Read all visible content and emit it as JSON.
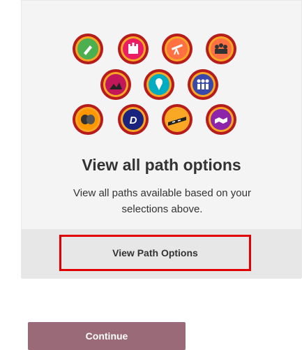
{
  "card": {
    "title": "View all path options",
    "description": "View all paths available based on your selections above.",
    "button_label": "View Path Options"
  },
  "footer": {
    "continue_label": "Continue"
  },
  "badges": [
    {
      "name": "microphone-badge-icon",
      "color": "#4caf50"
    },
    {
      "name": "castle-badge-icon",
      "color": "#e91e63"
    },
    {
      "name": "telescope-badge-icon",
      "color": "#ff7043"
    },
    {
      "name": "crowd-badge-icon",
      "color": "#ff7043"
    },
    {
      "name": "concert-badge-icon",
      "color": "#c2185b"
    },
    {
      "name": "ice-cream-badge-icon",
      "color": "#00acc1"
    },
    {
      "name": "team-badge-icon",
      "color": "#3949ab"
    },
    {
      "name": "theater-masks-badge-icon",
      "color": "#ff9800"
    },
    {
      "name": "d-letter-badge-icon",
      "color": "#1a237e"
    },
    {
      "name": "road-badge-icon",
      "color": "#f9a825"
    },
    {
      "name": "handshake-badge-icon",
      "color": "#8e24aa"
    }
  ]
}
